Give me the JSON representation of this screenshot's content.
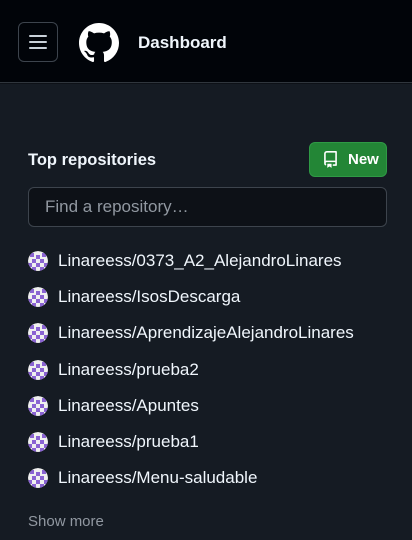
{
  "header": {
    "menu_icon": "hamburger-menu-icon",
    "logo_icon": "github-octocat-icon",
    "title": "Dashboard"
  },
  "top_repositories": {
    "title": "Top repositories",
    "new_button_label": "New",
    "new_button_icon": "repo-icon",
    "search_placeholder": "Find a repository…",
    "repos": [
      {
        "name": "Linareess/0373_A2_AlejandroLinares"
      },
      {
        "name": "Linareess/IsosDescarga"
      },
      {
        "name": "Linareess/AprendizajeAlejandroLinares"
      },
      {
        "name": "Linareess/prueba2"
      },
      {
        "name": "Linareess/Apuntes"
      },
      {
        "name": "Linareess/prueba1"
      },
      {
        "name": "Linareess/Menu-saludable"
      }
    ],
    "show_more": "Show more"
  },
  "colors": {
    "header_bg": "#010409",
    "sidebar_bg": "#151b23",
    "new_button_bg": "#238636",
    "avatar_accent": "#8a63d2"
  }
}
